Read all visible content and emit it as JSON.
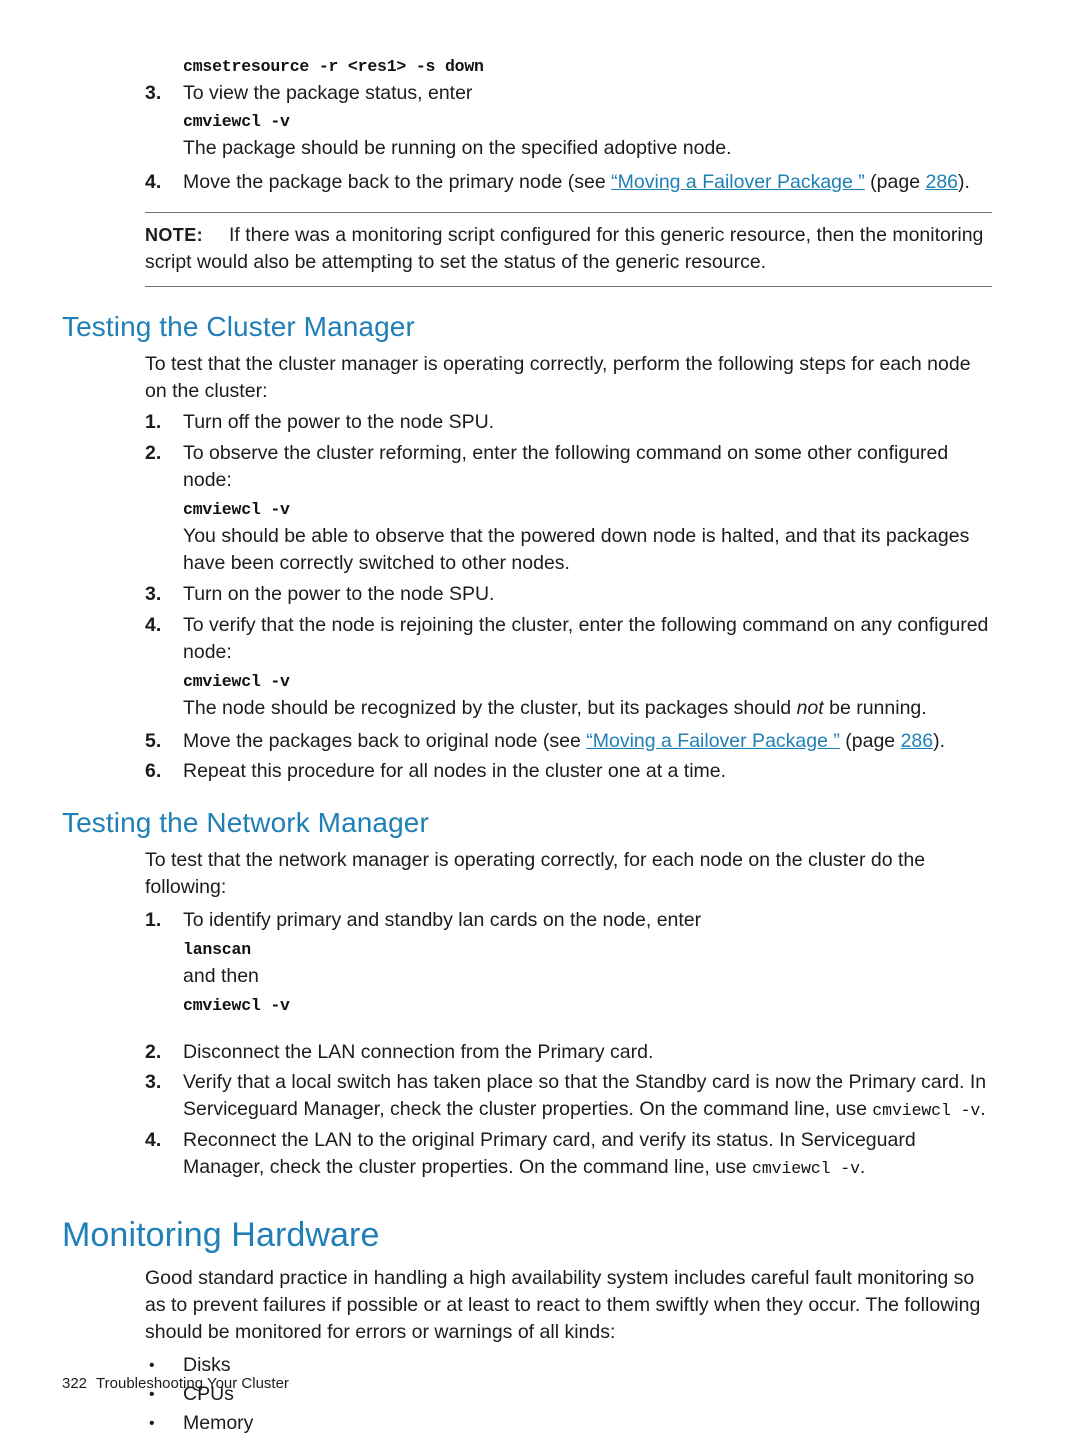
{
  "document": {
    "top_command": "cmsetresource -r <res1> -s down",
    "steps_top": [
      {
        "num": "3.",
        "text": "To view the package status, enter",
        "command": "cmviewcl -v",
        "after": "The package should be running on the specified adoptive node."
      },
      {
        "num": "4.",
        "text_before": "Move the package back to the primary node (see ",
        "link": "“Moving a Failover Package ”",
        "text_mid": " (page ",
        "link2": "286",
        "text_after": ")."
      }
    ],
    "note": {
      "label": "NOTE:",
      "text": "If there was a monitoring script configured for this generic resource, then the monitoring script would also be attempting to set the status of the generic resource."
    },
    "section_cluster_manager": {
      "heading": "Testing the Cluster Manager",
      "intro": "To test that the cluster manager is operating correctly, perform the following steps for each node on the cluster:",
      "steps": [
        {
          "num": "1.",
          "text": "Turn off the power to the node SPU."
        },
        {
          "num": "2.",
          "text": "To observe the cluster reforming, enter the following command on some other configured node:",
          "command": "cmviewcl -v",
          "after": "You should be able to observe that the powered down node is halted, and that its packages have been correctly switched to other nodes."
        },
        {
          "num": "3.",
          "text": "Turn on the power to the node SPU."
        },
        {
          "num": "4.",
          "text": "To verify that the node is rejoining the cluster, enter the following command on any configured node:",
          "command": "cmviewcl -v",
          "after_1": "The node should be recognized by the cluster, but its packages should ",
          "after_italic": "not",
          "after_2": " be running."
        },
        {
          "num": "5.",
          "text_before": "Move the packages back to original node (see ",
          "link": "“Moving a Failover Package ”",
          "text_mid": " (page ",
          "link2": "286",
          "text_after": ")."
        },
        {
          "num": "6.",
          "text": "Repeat this procedure for all nodes in the cluster one at a time."
        }
      ]
    },
    "section_network_manager": {
      "heading": "Testing the Network Manager",
      "intro": "To test that the network manager is operating correctly, for each node on the cluster do the following:",
      "steps": [
        {
          "num": "1.",
          "text": "To identify primary and standby lan cards on the node, enter",
          "command": "lanscan",
          "middle": "and then",
          "command2": "cmviewcl -v"
        },
        {
          "num": "2.",
          "text": "Disconnect the LAN connection from the Primary card."
        },
        {
          "num": "3.",
          "text_1": "Verify that a local switch has taken place so that the Standby card is now the Primary card. In Serviceguard Manager, check the cluster properties. On the command line, use ",
          "mono_1": "cmviewcl -v",
          "text_2": "."
        },
        {
          "num": "4.",
          "text_1": "Reconnect the LAN to the original Primary card, and verify its status. In Serviceguard Manager, check the cluster properties. On the command line, use ",
          "mono_1": "cmviewcl -v",
          "text_2": "."
        }
      ]
    },
    "section_monitoring": {
      "heading": "Monitoring Hardware",
      "intro": "Good standard practice in handling a high availability system includes careful fault monitoring so as to prevent failures if possible or at least to react to them swiftly when they occur. The following should be monitored for errors or warnings of all kinds:",
      "bullets": [
        "Disks",
        "CPUs",
        "Memory"
      ],
      "bullet_glyph": "•"
    },
    "footer": {
      "page_number": "322",
      "title": "Troubleshooting Your Cluster"
    }
  }
}
